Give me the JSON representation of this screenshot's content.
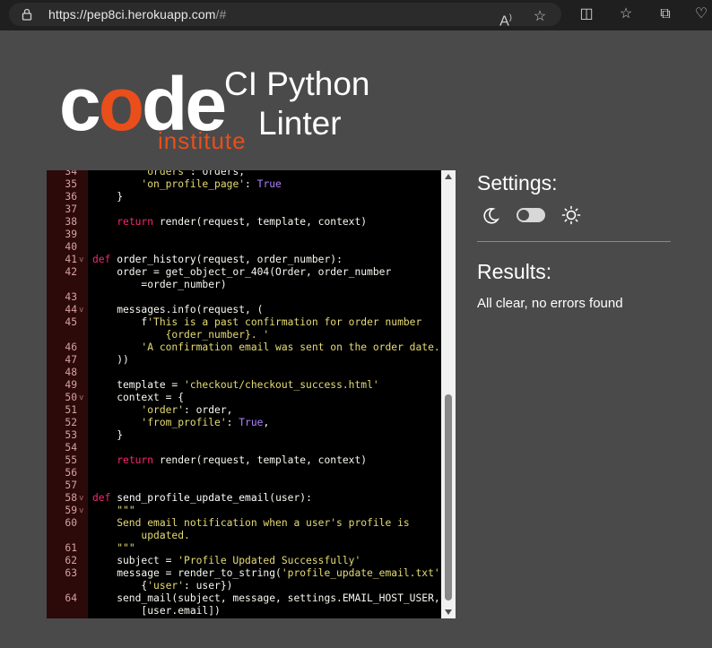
{
  "browser": {
    "url_host": "https://pep8ci.herokuapp.com",
    "url_path": "/#"
  },
  "header": {
    "logo_word_c": "c",
    "logo_word_o": "o",
    "logo_word_de": "de",
    "logo_sub": "institute",
    "app_title_line1": "CI Python",
    "app_title_line2": "Linter"
  },
  "editor": {
    "lines": [
      {
        "n": "34",
        "fold": "",
        "parts": [
          [
            "",
            "        "
          ],
          [
            "str",
            "'orders'"
          ],
          [
            "",
            ": orders,"
          ]
        ]
      },
      {
        "n": "35",
        "fold": "",
        "parts": [
          [
            "",
            "        "
          ],
          [
            "str",
            "'on_profile_page'"
          ],
          [
            "",
            ": "
          ],
          [
            "cst",
            "True"
          ]
        ]
      },
      {
        "n": "36",
        "fold": "",
        "parts": [
          [
            "",
            "    }"
          ]
        ]
      },
      {
        "n": "37",
        "fold": "",
        "parts": []
      },
      {
        "n": "38",
        "fold": "",
        "parts": [
          [
            "",
            "    "
          ],
          [
            "kw",
            "return"
          ],
          [
            "",
            " render(request, template, context)"
          ]
        ]
      },
      {
        "n": "39",
        "fold": "",
        "parts": []
      },
      {
        "n": "40",
        "fold": "",
        "parts": []
      },
      {
        "n": "41",
        "fold": "v",
        "parts": [
          [
            "kw",
            "def"
          ],
          [
            "",
            " "
          ],
          [
            "fn",
            "order_history"
          ],
          [
            "",
            "(request, order_number):"
          ]
        ]
      },
      {
        "n": "42",
        "fold": "",
        "wrap": true,
        "parts": [
          [
            "",
            "    order = get_object_or_404(Order, order_number\n        =order_number)"
          ]
        ]
      },
      {
        "n": "43",
        "fold": "",
        "parts": []
      },
      {
        "n": "44",
        "fold": "v",
        "parts": [
          [
            "",
            "    messages.info(request, ("
          ]
        ]
      },
      {
        "n": "45",
        "fold": "",
        "wrap": true,
        "parts": [
          [
            "",
            "        f"
          ],
          [
            "str",
            "'This is a past confirmation for order number\n            {order_number}. '"
          ]
        ]
      },
      {
        "n": "46",
        "fold": "",
        "parts": [
          [
            "",
            "        "
          ],
          [
            "str",
            "'A confirmation email was sent on the order date.'"
          ]
        ]
      },
      {
        "n": "47",
        "fold": "",
        "parts": [
          [
            "",
            "    ))"
          ]
        ]
      },
      {
        "n": "48",
        "fold": "",
        "parts": []
      },
      {
        "n": "49",
        "fold": "",
        "parts": [
          [
            "",
            "    template = "
          ],
          [
            "str",
            "'checkout/checkout_success.html'"
          ]
        ]
      },
      {
        "n": "50",
        "fold": "v",
        "parts": [
          [
            "",
            "    context = {"
          ]
        ]
      },
      {
        "n": "51",
        "fold": "",
        "parts": [
          [
            "",
            "        "
          ],
          [
            "str",
            "'order'"
          ],
          [
            "",
            ": order,"
          ]
        ]
      },
      {
        "n": "52",
        "fold": "",
        "parts": [
          [
            "",
            "        "
          ],
          [
            "str",
            "'from_profile'"
          ],
          [
            "",
            ": "
          ],
          [
            "cst",
            "True"
          ],
          [
            "",
            ","
          ]
        ]
      },
      {
        "n": "53",
        "fold": "",
        "parts": [
          [
            "",
            "    }"
          ]
        ]
      },
      {
        "n": "54",
        "fold": "",
        "parts": []
      },
      {
        "n": "55",
        "fold": "",
        "parts": [
          [
            "",
            "    "
          ],
          [
            "kw",
            "return"
          ],
          [
            "",
            " render(request, template, context)"
          ]
        ]
      },
      {
        "n": "56",
        "fold": "",
        "parts": []
      },
      {
        "n": "57",
        "fold": "",
        "parts": []
      },
      {
        "n": "58",
        "fold": "v",
        "parts": [
          [
            "kw",
            "def"
          ],
          [
            "",
            " "
          ],
          [
            "fn",
            "send_profile_update_email"
          ],
          [
            "",
            "(user):"
          ]
        ]
      },
      {
        "n": "59",
        "fold": "v",
        "parts": [
          [
            "",
            "    "
          ],
          [
            "str",
            "\"\"\""
          ]
        ]
      },
      {
        "n": "60",
        "fold": "",
        "wrap": true,
        "parts": [
          [
            "str",
            "    Send email notification when a user's profile is\n        updated."
          ]
        ]
      },
      {
        "n": "61",
        "fold": "",
        "parts": [
          [
            "",
            "    "
          ],
          [
            "str",
            "\"\"\""
          ]
        ]
      },
      {
        "n": "62",
        "fold": "",
        "parts": [
          [
            "",
            "    subject = "
          ],
          [
            "str",
            "'Profile Updated Successfully'"
          ]
        ]
      },
      {
        "n": "63",
        "fold": "",
        "wrap": true,
        "parts": [
          [
            "",
            "    message = render_to_string("
          ],
          [
            "str",
            "'profile_update_email.txt'"
          ],
          [
            "",
            ",\n        {"
          ],
          [
            "str",
            "'user'"
          ],
          [
            "",
            ": user})"
          ]
        ]
      },
      {
        "n": "64",
        "fold": "",
        "wrap": true,
        "parts": [
          [
            "",
            "    send_mail(subject, message, settings.EMAIL_HOST_USER,\n        [user.email])"
          ]
        ]
      }
    ]
  },
  "settings": {
    "title": "Settings:"
  },
  "results": {
    "title": "Results:",
    "message": "All clear, no errors found"
  }
}
